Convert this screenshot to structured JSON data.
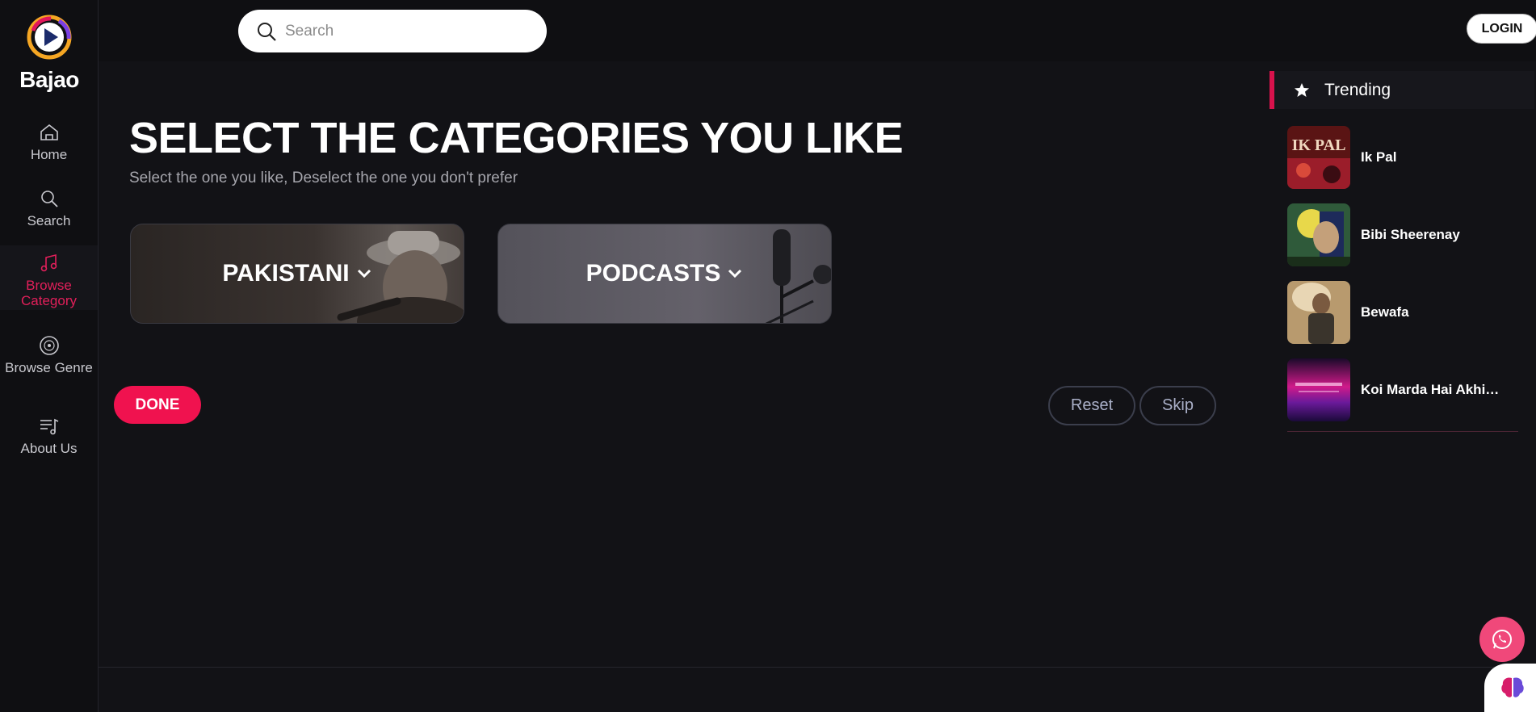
{
  "app": {
    "name": "Bajao",
    "accent": "#f0124f"
  },
  "sidebar": {
    "items": [
      {
        "label": "Home",
        "icon": "home-icon",
        "active": false
      },
      {
        "label": "Search",
        "icon": "search-icon",
        "active": false
      },
      {
        "label": "Browse Category",
        "icon": "music-note-icon",
        "active": true
      },
      {
        "label": "Browse Genre",
        "icon": "vinyl-icon",
        "active": false
      },
      {
        "label": "About Us",
        "icon": "playlist-icon",
        "active": false
      }
    ]
  },
  "header": {
    "search_placeholder": "Search",
    "login_label": "LOGIN"
  },
  "main": {
    "title": "SELECT THE CATEGORIES YOU LIKE",
    "subtitle": "Select the one you like, Deselect the one you don't prefer",
    "categories": [
      {
        "label": "PAKISTANI",
        "icon": "chevron-down-icon"
      },
      {
        "label": "PODCASTS",
        "icon": "chevron-down-icon"
      }
    ],
    "done_label": "DONE",
    "reset_label": "Reset",
    "skip_label": "Skip"
  },
  "trending": {
    "heading": "Trending",
    "icon": "star-icon",
    "items": [
      {
        "title": "Ik Pal"
      },
      {
        "title": "Bibi Sheerenay"
      },
      {
        "title": "Bewafa"
      },
      {
        "title": "Koi Marda Hai Akhian ..."
      }
    ]
  },
  "floating": {
    "whatsapp_icon": "whatsapp-icon",
    "assistant_icon": "brain-icon"
  }
}
